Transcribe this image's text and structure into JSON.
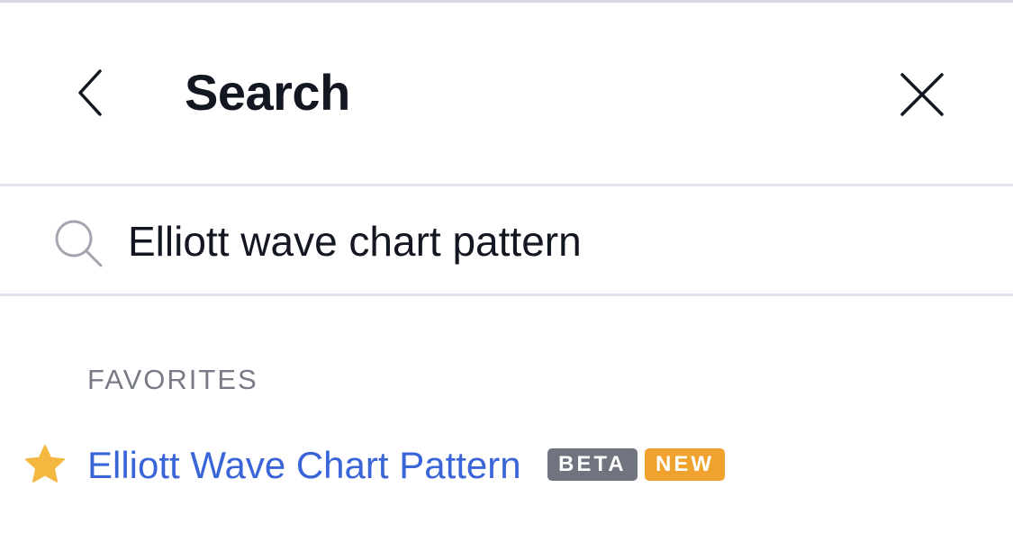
{
  "header": {
    "title": "Search",
    "back_icon": "chevron-left-icon",
    "close_icon": "close-icon"
  },
  "search": {
    "value": "Elliott wave chart pattern",
    "icon": "search-icon"
  },
  "favorites": {
    "section_label": "FAVORITES",
    "items": [
      {
        "label": "Elliott Wave Chart Pattern",
        "icon": "star-icon",
        "badges": [
          "BETA",
          "NEW"
        ]
      }
    ]
  },
  "colors": {
    "link": "#3a65d8",
    "star": "#f4b841",
    "badge_beta": "#70747f",
    "badge_new": "#f0a22e",
    "title": "#131722",
    "muted": "#787b86"
  }
}
